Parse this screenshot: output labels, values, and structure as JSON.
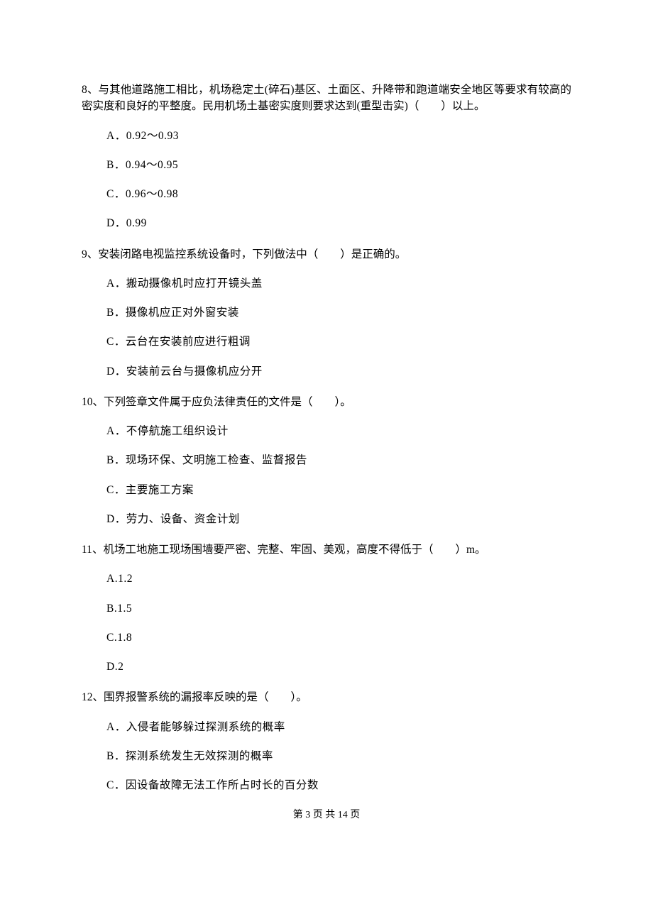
{
  "questions": [
    {
      "number": "8、",
      "text": "与其他道路施工相比，机场稳定土(碎石)基区、土面区、升降带和跑道端安全地区等要求有较高的密实度和良好的平整度。民用机场土基密实度则要求达到(重型击实)（　　）以上。",
      "options": [
        "A．0.92～0.93",
        "B．0.94～0.95",
        "C．0.96～0.98",
        "D．0.99"
      ]
    },
    {
      "number": "9、",
      "text": "安装闭路电视监控系统设备时，下列做法中（　　）是正确的。",
      "options": [
        "A．搬动摄像机时应打开镜头盖",
        "B．摄像机应正对外窗安装",
        "C．云台在安装前应进行粗调",
        "D．安装前云台与摄像机应分开"
      ]
    },
    {
      "number": "10、",
      "text": "下列签章文件属于应负法律责任的文件是（　　）。",
      "options": [
        "A．不停航施工组织设计",
        "B．现场环保、文明施工检查、监督报告",
        "C．主要施工方案",
        "D．劳力、设备、资金计划"
      ]
    },
    {
      "number": "11、",
      "text": "机场工地施工现场围墙要严密、完整、牢固、美观，高度不得低于（　　）m。",
      "options": [
        "A.1.2",
        "B.1.5",
        "C.1.8",
        "D.2"
      ]
    },
    {
      "number": "12、",
      "text": "围界报警系统的漏报率反映的是（　　）。",
      "options": [
        "A．入侵者能够躲过探测系统的概率",
        "B．探测系统发生无效探测的概率",
        "C．因设备故障无法工作所占时长的百分数"
      ]
    }
  ],
  "footer": "第 3 页 共 14 页"
}
